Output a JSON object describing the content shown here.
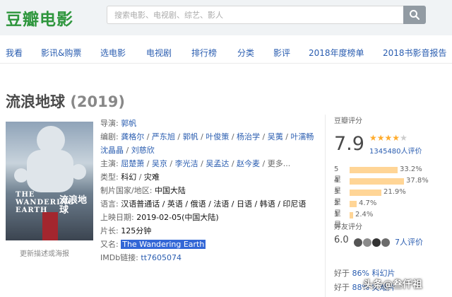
{
  "header": {
    "logo": "豆瓣电影",
    "search_placeholder": "搜索电影、电视剧、综艺、影人"
  },
  "nav": [
    {
      "label": "我看"
    },
    {
      "label": "影讯&购票"
    },
    {
      "label": "选电影"
    },
    {
      "label": "电视剧"
    },
    {
      "label": "排行榜"
    },
    {
      "label": "分类"
    },
    {
      "label": "影评"
    },
    {
      "label": "2018年度榜单"
    },
    {
      "label": "2018书影音报告"
    }
  ],
  "movie": {
    "title": "流浪地球",
    "year": "(2019)",
    "poster_link": "更新描述或海报",
    "poster_text_en": "THE WANDERING EARTH",
    "poster_text_cn": "流浪地球",
    "director_label": "导演:",
    "director": "郭帆",
    "writers_label": "编剧:",
    "writers": [
      "龚格尔",
      "严东旭",
      "郭帆",
      "叶俊策",
      "杨治学",
      "吴荑",
      "叶濡畅",
      "沈晶晶",
      "刘慈欣"
    ],
    "cast_label": "主演:",
    "cast": [
      "屈楚萧",
      "吴京",
      "李光洁",
      "吴孟达",
      "赵今麦"
    ],
    "cast_more": "更多...",
    "genre_label": "类型:",
    "genres": [
      "科幻",
      "灾难"
    ],
    "country_label": "制片国家/地区:",
    "country": "中国大陆",
    "language_label": "语言:",
    "languages": "汉语普通话 / 英语 / 俄语 / 法语 / 日语 / 韩语 / 印尼语",
    "release_label": "上映日期:",
    "release": "2019-02-05(中国大陆)",
    "runtime_label": "片长:",
    "runtime": "125分钟",
    "aka_label": "又名:",
    "aka": "The Wandering Earth",
    "imdb_label": "IMDb链接:",
    "imdb": "tt7605074"
  },
  "rating": {
    "label": "豆瓣评分",
    "score": "7.9",
    "stars_filled": 4,
    "count": "1345480人评价",
    "distribution": [
      {
        "label": "5星",
        "pct": "33.2%",
        "value": 33.2
      },
      {
        "label": "4星",
        "pct": "37.8%",
        "value": 37.8
      },
      {
        "label": "3星",
        "pct": "21.9%",
        "value": 21.9
      },
      {
        "label": "2星",
        "pct": "4.7%",
        "value": 4.7
      },
      {
        "label": "1星",
        "pct": "2.4%",
        "value": 2.4
      }
    ],
    "friend_label": "好友评分",
    "friend_score": "6.0",
    "friend_count": "7人评价",
    "better_1_prefix": "好于",
    "better_1_pct": "86% 科幻片",
    "better_2_prefix": "好于",
    "better_2_pct": "88% 灾难片"
  },
  "watermark": "头条@叁仟祖",
  "colors": {
    "brand_green": "#2e963d",
    "link_blue": "#2a5db0",
    "star_orange": "#ffac2d",
    "bar_fill": "#ffd596",
    "highlight": "#3367d6"
  }
}
